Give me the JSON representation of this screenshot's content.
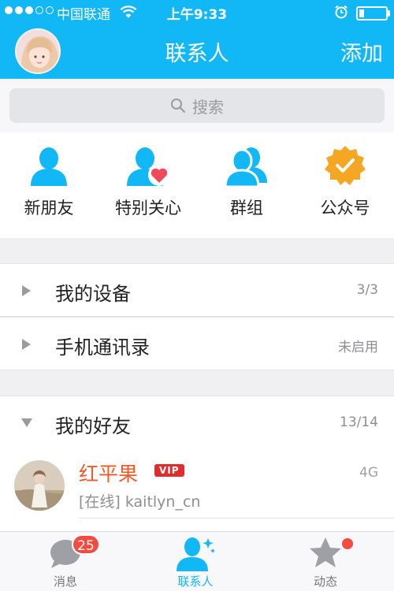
{
  "status_bar": {
    "carrier": "中国联通",
    "time": "上午9:33",
    "signal_strength": 3,
    "signal_max": 5,
    "battery_level": 0.2
  },
  "header": {
    "title": "联系人",
    "add_label": "添加"
  },
  "search": {
    "placeholder": "搜索"
  },
  "shortcuts": [
    {
      "label": "新朋友",
      "icon": "new-friend-icon"
    },
    {
      "label": "特别关心",
      "icon": "special-care-icon"
    },
    {
      "label": "群组",
      "icon": "groups-icon"
    },
    {
      "label": "公众号",
      "icon": "official-accounts-icon"
    }
  ],
  "groups": [
    {
      "label": "我的设备",
      "count": "3/3",
      "expanded": false
    },
    {
      "label": "手机通讯录",
      "count": "未启用",
      "expanded": false
    },
    {
      "label": "我的好友",
      "count": "13/14",
      "expanded": true
    }
  ],
  "friends": [
    {
      "name": "红平果",
      "badge": "VIP",
      "network": "4G",
      "status": "[在线]  kaitlyn_cn"
    }
  ],
  "tabbar": {
    "tabs": [
      {
        "label": "消息",
        "badge": "25",
        "active": false
      },
      {
        "label": "联系人",
        "active": true
      },
      {
        "label": "动态",
        "active": false,
        "dot": true
      }
    ]
  },
  "colors": {
    "accent": "#12b7f5",
    "name_highlight": "#f05a28",
    "badge": "#f24b3f",
    "special_care_heart": "#ee4a5c",
    "official_accounts": "#f5a623"
  }
}
